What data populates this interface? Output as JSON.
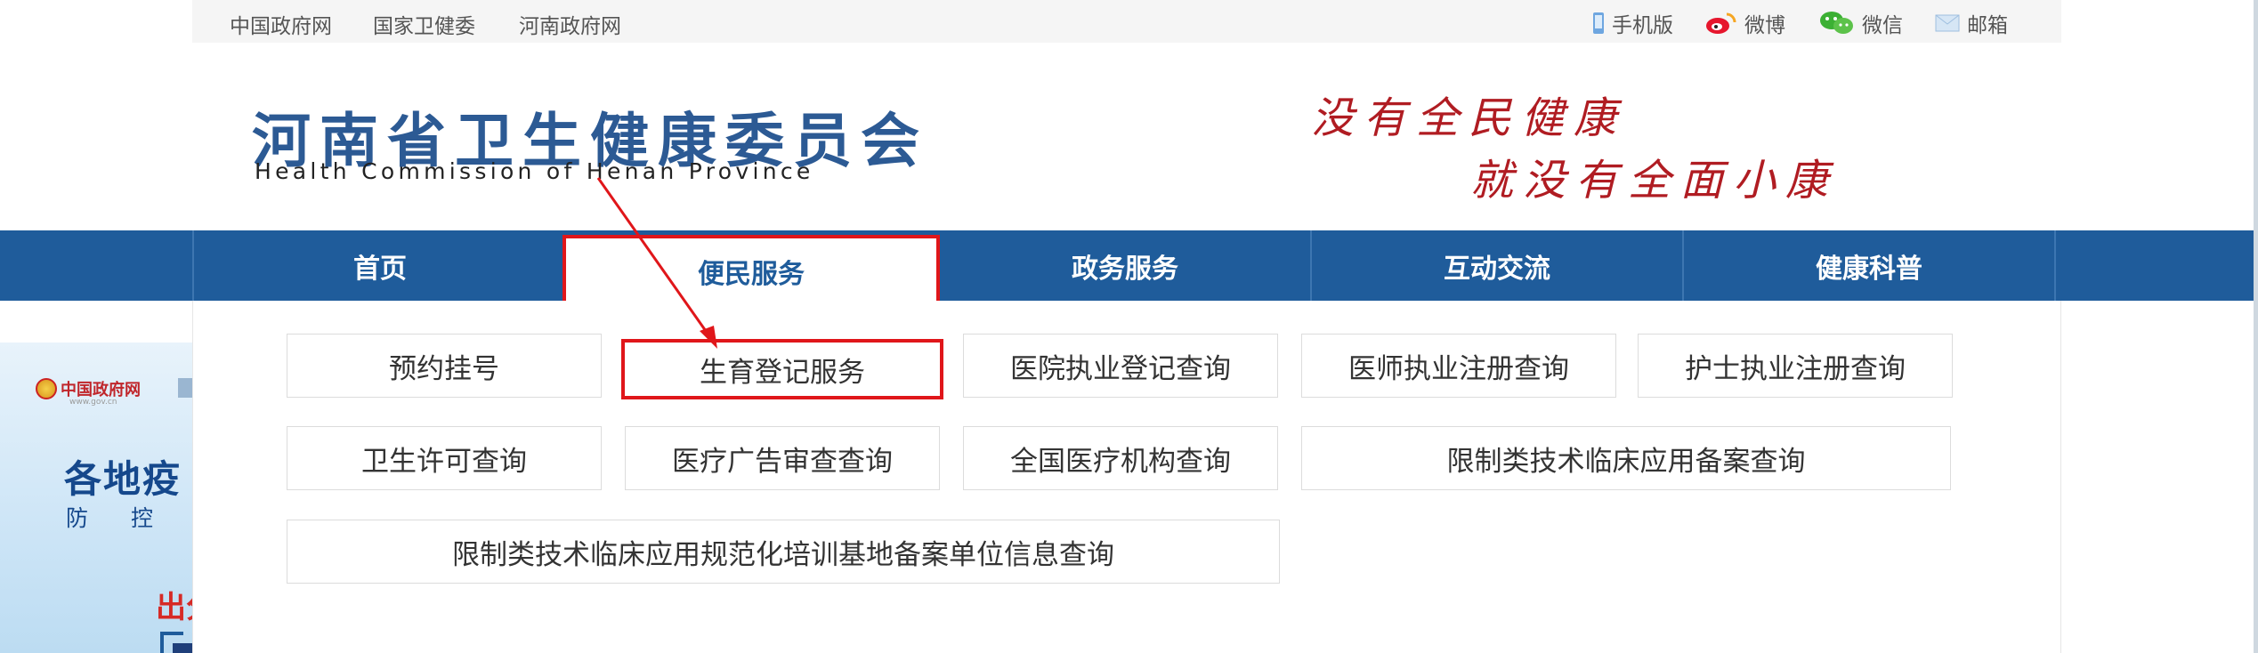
{
  "top_links": [
    "中国政府网",
    "国家卫健委",
    "河南政府网"
  ],
  "top_right": {
    "mobile": "手机版",
    "weibo": "微博",
    "wechat": "微信",
    "email": "邮箱"
  },
  "header": {
    "title_cn": "河南省卫生健康委员会",
    "title_en": "Health Commission of Henan Province",
    "slogan_line1": "没有全民健康",
    "slogan_line2": "就没有全面小康"
  },
  "nav": {
    "items": [
      "首页",
      "便民服务",
      "政务服务",
      "互动交流",
      "健康科普"
    ],
    "active_index": 1
  },
  "services": [
    "预约挂号",
    "生育登记服务",
    "医院执业登记查询",
    "医师执业注册查询",
    "护士执业注册查询",
    "卫生许可查询",
    "医疗广告审查查询",
    "全国医疗机构查询",
    "限制类技术临床应用备案查询",
    "限制类技术临床应用规范化培训基地备案单位信息查询"
  ],
  "banner": {
    "gov_label": "中国政府网",
    "gov_url": "www.gov.cn",
    "main_text": "各地疫",
    "sub_text": "防 控 新",
    "red_text": "出分"
  },
  "colors": {
    "nav_blue": "#1f5c9b",
    "highlight_red": "#e0161a",
    "title_blue": "#2c5a94",
    "slogan_red": "#b01c22"
  }
}
